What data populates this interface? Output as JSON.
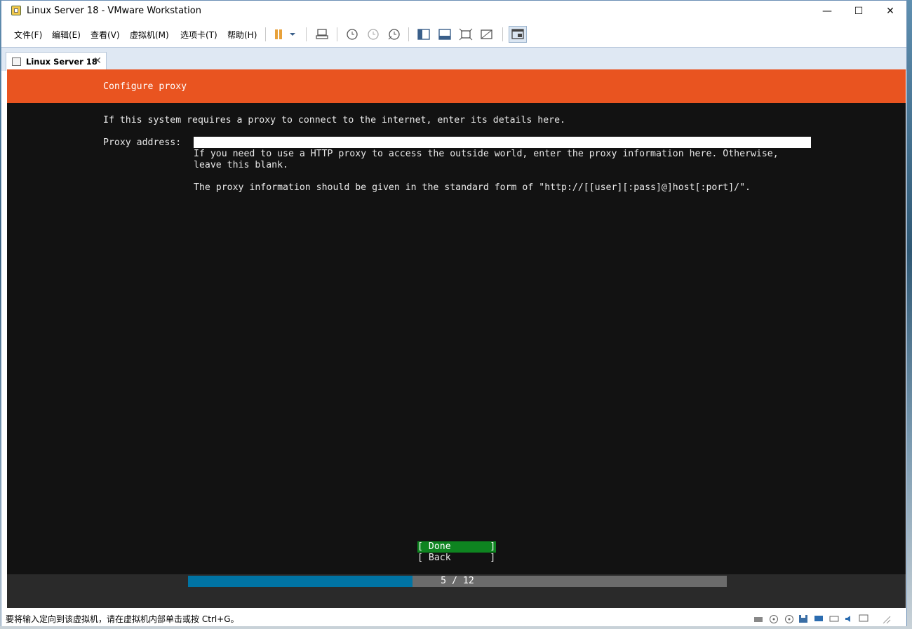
{
  "window": {
    "title": "Linux Server 18 - VMware Workstation"
  },
  "window_controls": {
    "minimize": "—",
    "maximize": "☐",
    "close": "✕"
  },
  "menu": {
    "items": [
      {
        "label": "文件(F)"
      },
      {
        "label": "编辑(E)"
      },
      {
        "label": "查看(V)"
      },
      {
        "label": "虚拟机(M)"
      },
      {
        "label": "选项卡(T)"
      },
      {
        "label": "帮助(H)"
      }
    ]
  },
  "tab": {
    "label": "Linux Server 18",
    "close": "✕"
  },
  "installer": {
    "header_title": "Configure proxy",
    "intro": "If this system requires a proxy to connect to the internet, enter its details here.",
    "field_label": "Proxy address:",
    "field_value": "",
    "help_line1": "If you need to use a HTTP proxy to access the outside world, enter the proxy information here. Otherwise,",
    "help_line2": "leave this blank.",
    "help_line3": "The proxy information should be given in the standard form of \"http://[[user][:pass]@]host[:port]/\".",
    "done_button": "[ Done       ]",
    "back_button": "[ Back       ]",
    "progress_text": "5 / 12",
    "progress_fraction": 0.4167
  },
  "colors": {
    "accent": "#e95420",
    "done_bg": "#0e8420",
    "progress_fill": "#0073a3"
  },
  "statusbar": {
    "text": "要将输入定向到该虚拟机，请在虚拟机内部单击或按 Ctrl+G。"
  }
}
